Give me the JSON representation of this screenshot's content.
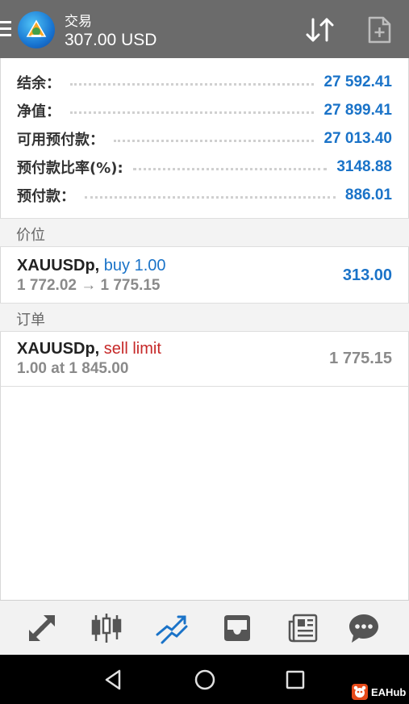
{
  "header": {
    "title": "交易",
    "balance": "307.00 USD"
  },
  "summary": [
    {
      "label": "结余：",
      "value": "27 592.41"
    },
    {
      "label": "净值：",
      "value": "27 899.41"
    },
    {
      "label": "可用预付款：",
      "value": "27 013.40"
    },
    {
      "label": "预付款比率(%):",
      "value": "3148.88"
    },
    {
      "label": "预付款：",
      "value": "886.01"
    }
  ],
  "positions_section": {
    "title": "价位"
  },
  "position": {
    "symbol": "XAUUSDp,",
    "side": "buy 1.00",
    "prices": "1 772.02 → 1 775.15",
    "profit": "313.00"
  },
  "orders_section": {
    "title": "订单"
  },
  "order": {
    "symbol": "XAUUSDp,",
    "type": "sell limit",
    "details": "1.00 at 1 845.00",
    "current_price": "1 775.15"
  },
  "tabs": [
    {
      "icon": "quotes-icon"
    },
    {
      "icon": "chart-icon"
    },
    {
      "icon": "trade-icon",
      "active": true
    },
    {
      "icon": "history-icon"
    },
    {
      "icon": "news-icon"
    },
    {
      "icon": "chat-icon"
    }
  ],
  "colors": {
    "header_bg": "#6b6b6b",
    "value_blue": "#1a73c8",
    "sell_red": "#c62828",
    "muted_gray": "#8a8a8a",
    "tab_icon": "#555555",
    "tab_active": "#1a73c8"
  },
  "watermark": {
    "text": "EAHub"
  }
}
